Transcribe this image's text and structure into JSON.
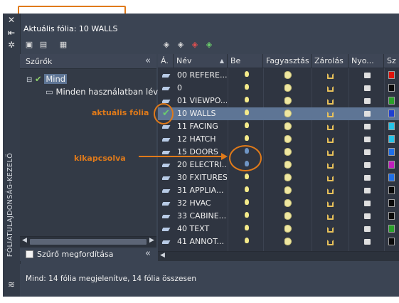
{
  "palette": {
    "current_layer_label": "Aktuális fólia: 10 WALLS",
    "vertical_title": "FÓLIATULAJDONSÁG-KEZELŐ",
    "sidebar_icons": [
      "close-icon",
      "pin-icon",
      "settings-icon"
    ]
  },
  "toolbar": {
    "left_icons": [
      "new-filter-icon",
      "new-group-filter-icon",
      "layer-states-icon"
    ],
    "right_icons": [
      "new-layer-icon",
      "new-layer-vp-frozen-icon",
      "delete-layer-icon",
      "set-current-icon"
    ]
  },
  "filters": {
    "header": "Szűrők",
    "collapse_glyph": "«",
    "tree": [
      {
        "label": "Mind",
        "level": 0
      },
      {
        "label": "Minden használatban lév",
        "level": 1
      }
    ],
    "invert_label": "Szűrő megfordítása",
    "invert_checked": false
  },
  "grid": {
    "columns": [
      "Á.",
      "Név",
      "Be",
      "Fagyasztás",
      "Zárolás",
      "Nyo...",
      "Sz"
    ],
    "rows": [
      {
        "name": "00 REFERE...",
        "on": true,
        "color": "#e0140c"
      },
      {
        "name": "0",
        "on": true,
        "color": "#0a0a0a"
      },
      {
        "name": "01 VIEWPO...",
        "on": true,
        "color": "#2aa02a"
      },
      {
        "name": "10 WALLS",
        "on": true,
        "color": "#1f3fd0",
        "current": true
      },
      {
        "name": "11 FACING",
        "on": true,
        "color": "#25c2e8"
      },
      {
        "name": "12 HATCH",
        "on": true,
        "color": "#25c2e8"
      },
      {
        "name": "15 DOORS",
        "on": false,
        "color": "#1f6fe8"
      },
      {
        "name": "20 ELECTRI...",
        "on": false,
        "color": "#c21fbd"
      },
      {
        "name": "30 FXITURES",
        "on": true,
        "color": "#1f6fe8"
      },
      {
        "name": "31 APPLIA...",
        "on": true,
        "color": "#0a0a0a"
      },
      {
        "name": "32 HVAC",
        "on": true,
        "color": "#0a0a0a"
      },
      {
        "name": "33 CABINE...",
        "on": true,
        "color": "#0a0a0a"
      },
      {
        "name": "40 TEXT",
        "on": true,
        "color": "#2aa02a"
      },
      {
        "name": "41 ANNOT...",
        "on": true,
        "color": "#0a0a0a"
      }
    ]
  },
  "status": {
    "text": "Mind: 14 fólia megjelenítve, 14 fólia összesen"
  },
  "annotations": {
    "current_layer": "aktuális fólia",
    "turned_off": "kikapcsolva"
  },
  "colors": {
    "accent": "#e07a1a",
    "selected_row": "#5e7595",
    "panel_bg": "#3b4453"
  }
}
